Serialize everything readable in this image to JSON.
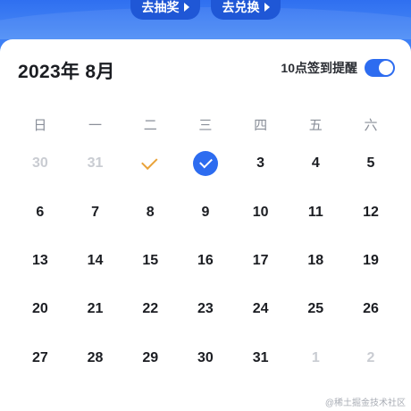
{
  "header": {
    "lottery_button": "去抽奖",
    "exchange_button": "去兑换"
  },
  "calendar": {
    "title": "2023年 8月",
    "reminder_label": "10点签到提醒",
    "reminder_enabled": true,
    "weekdays": [
      "日",
      "一",
      "二",
      "三",
      "四",
      "五",
      "六"
    ],
    "days": [
      {
        "label": "30",
        "muted": true
      },
      {
        "label": "31",
        "muted": true
      },
      {
        "label": "",
        "state": "checked"
      },
      {
        "label": "",
        "state": "checked-today"
      },
      {
        "label": "3"
      },
      {
        "label": "4"
      },
      {
        "label": "5"
      },
      {
        "label": "6"
      },
      {
        "label": "7"
      },
      {
        "label": "8"
      },
      {
        "label": "9"
      },
      {
        "label": "10"
      },
      {
        "label": "11"
      },
      {
        "label": "12"
      },
      {
        "label": "13"
      },
      {
        "label": "14"
      },
      {
        "label": "15"
      },
      {
        "label": "16"
      },
      {
        "label": "17"
      },
      {
        "label": "18"
      },
      {
        "label": "19"
      },
      {
        "label": "20"
      },
      {
        "label": "21"
      },
      {
        "label": "22"
      },
      {
        "label": "23"
      },
      {
        "label": "24"
      },
      {
        "label": "25"
      },
      {
        "label": "26"
      },
      {
        "label": "27"
      },
      {
        "label": "28"
      },
      {
        "label": "29"
      },
      {
        "label": "30"
      },
      {
        "label": "31"
      },
      {
        "label": "1",
        "muted": true
      },
      {
        "label": "2",
        "muted": true
      }
    ]
  },
  "watermark": "@稀土掘金技术社区",
  "colors": {
    "accent": "#2d6cf0",
    "check_orange": "#e9a33a",
    "muted_text": "#c9ccd2"
  }
}
